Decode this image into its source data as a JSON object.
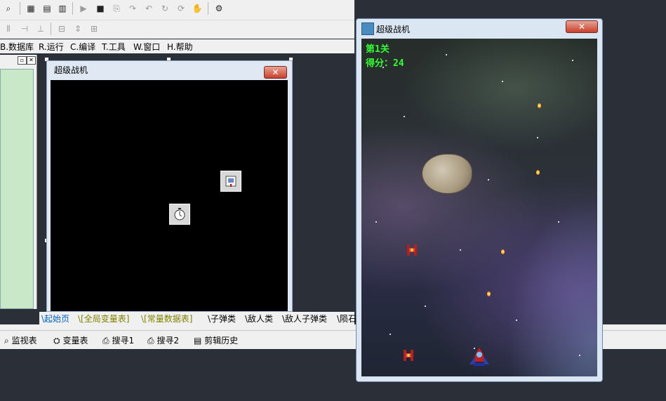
{
  "menubar": {
    "items": [
      {
        "key": "B",
        "label": "B.数据库"
      },
      {
        "key": "R",
        "label": "R.运行"
      },
      {
        "key": "C",
        "label": "C.编译"
      },
      {
        "key": "T",
        "label": "T.工具"
      },
      {
        "key": "W",
        "label": "W.窗口"
      },
      {
        "key": "H",
        "label": "H.帮助"
      }
    ]
  },
  "design_window": {
    "title": "超级战机",
    "close": "✕"
  },
  "bottom_tabs": [
    "\\起始页",
    "\\[全局变量表]",
    "\\[常量数据表]",
    "\\子弹类",
    "\\敌人类",
    "\\敌人子弹类",
    "\\陨石"
  ],
  "bottom_tools": {
    "watch": "监视表",
    "vars": "变量表",
    "search1": "搜寻1",
    "search2": "搜寻2",
    "clip": "剪辑历史"
  },
  "game_window": {
    "title": "超级战机",
    "close": "✕",
    "level": "第1关",
    "score": "得分：24"
  },
  "colors": {
    "hud_text": "#33ff33",
    "tab_active": "#0060c0",
    "tab_bracket": "#808000"
  },
  "icons": {
    "toolbar": [
      "preview-icon",
      "layout1-icon",
      "layout2-icon",
      "layout3-icon",
      "run-icon",
      "stop-icon",
      "step-icon",
      "stepinto-icon",
      "stepout-icon",
      "stepover-icon",
      "breakpoint-icon",
      "hand-icon",
      "debug-icon"
    ]
  }
}
